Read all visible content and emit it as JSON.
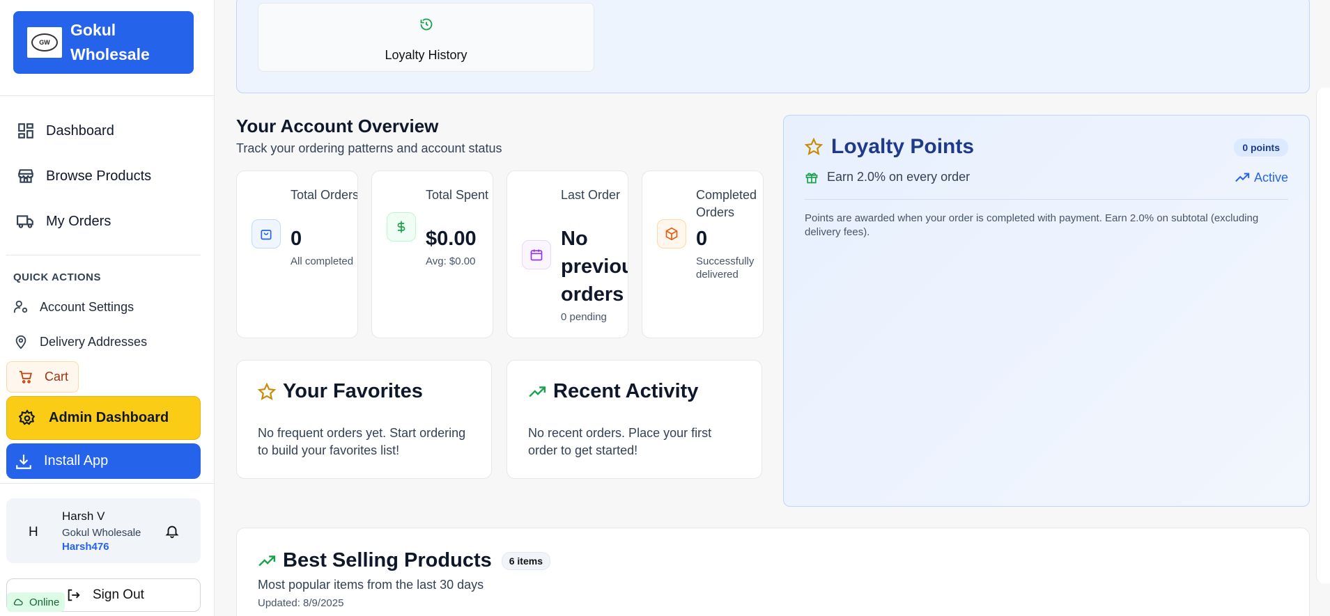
{
  "brand": {
    "logo_text": "GW",
    "name": "Gokul Wholesale"
  },
  "nav": [
    {
      "label": "Dashboard",
      "icon": "dashboard-icon"
    },
    {
      "label": "Browse Products",
      "icon": "store-icon"
    },
    {
      "label": "My Orders",
      "icon": "truck-icon"
    }
  ],
  "quick_actions": {
    "title": "QUICK ACTIONS",
    "account_settings": "Account Settings",
    "delivery_addresses": "Delivery Addresses",
    "cart": "Cart",
    "admin_dashboard": "Admin Dashboard",
    "install_app": "Install App"
  },
  "user": {
    "initial": "H",
    "name": "Harsh V",
    "org": "Gokul Wholesale",
    "handle": "Harsh476"
  },
  "sign_out": "Sign Out",
  "status": "Online",
  "loyalty_history": "Loyalty History",
  "overview": {
    "title": "Your Account Overview",
    "subtitle": "Track your ordering patterns and account status",
    "stats": [
      {
        "label": "Total Orders",
        "value": "0",
        "note": "All completed",
        "icon": "shopping-bag-icon",
        "color": "#2563eb"
      },
      {
        "label": "Total Spent",
        "value": "$0.00",
        "note": "Avg: $0.00",
        "icon": "dollar-icon",
        "color": "#16a34a"
      },
      {
        "label": "Last Order",
        "value": "No previous orders",
        "note": "0 pending",
        "icon": "calendar-icon",
        "color": "#9333ea"
      },
      {
        "label": "Completed Orders",
        "value": "0",
        "note": "Successfully delivered",
        "icon": "package-icon",
        "color": "#ea580c"
      }
    ]
  },
  "favorites": {
    "title": "Your Favorites",
    "text": "No frequent orders yet. Start ordering to build your favorites list!"
  },
  "recent": {
    "title": "Recent Activity",
    "text": "No recent orders. Place your first order to get started!"
  },
  "loyalty": {
    "title": "Loyalty Points",
    "badge": "0 points",
    "earn": "Earn 2.0% on every order",
    "status": "Active",
    "note": "Points are awarded when your order is completed with payment. Earn 2.0% on subtotal (excluding delivery fees)."
  },
  "best_selling": {
    "title": "Best Selling Products",
    "badge": "6 items",
    "subtitle": "Most popular items from the last 30 days",
    "updated": "Updated: 8/9/2025"
  }
}
